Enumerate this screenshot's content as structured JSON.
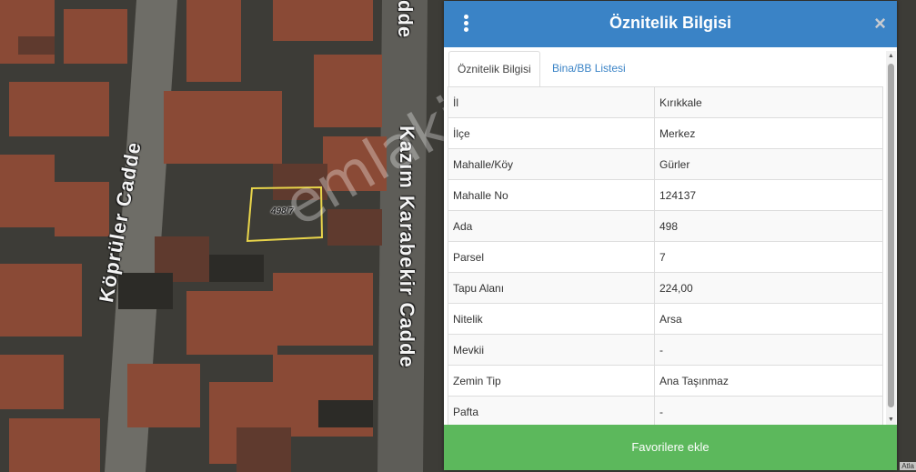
{
  "map": {
    "street_labels": [
      "Köprüler Cadde",
      "Kazım Karabekir Cadde",
      "dde"
    ],
    "parcel_label": "498/7",
    "watermark": "emlakjet.com",
    "attribution": "Atla"
  },
  "panel": {
    "title": "Öznitelik Bilgisi",
    "close_icon": "×",
    "menu_icon": "vertical-dots",
    "tabs": [
      {
        "label": "Öznitelik Bilgisi",
        "active": true
      },
      {
        "label": "Bina/BB Listesi",
        "active": false
      }
    ],
    "rows": [
      {
        "key": "İl",
        "value": "Kırıkkale"
      },
      {
        "key": "İlçe",
        "value": "Merkez"
      },
      {
        "key": "Mahalle/Köy",
        "value": "Gürler"
      },
      {
        "key": "Mahalle No",
        "value": "124137"
      },
      {
        "key": "Ada",
        "value": "498"
      },
      {
        "key": "Parsel",
        "value": "7"
      },
      {
        "key": "Tapu Alanı",
        "value": "224,00"
      },
      {
        "key": "Nitelik",
        "value": "Arsa"
      },
      {
        "key": "Mevkii",
        "value": "-"
      },
      {
        "key": "Zemin Tip",
        "value": "Ana Taşınmaz"
      },
      {
        "key": "Pafta",
        "value": "-"
      }
    ],
    "favorite_button": "Favorilere ekle",
    "colors": {
      "header": "#3a83c6",
      "favorite_button": "#5cb85c",
      "tab_link": "#3a83c6"
    }
  }
}
